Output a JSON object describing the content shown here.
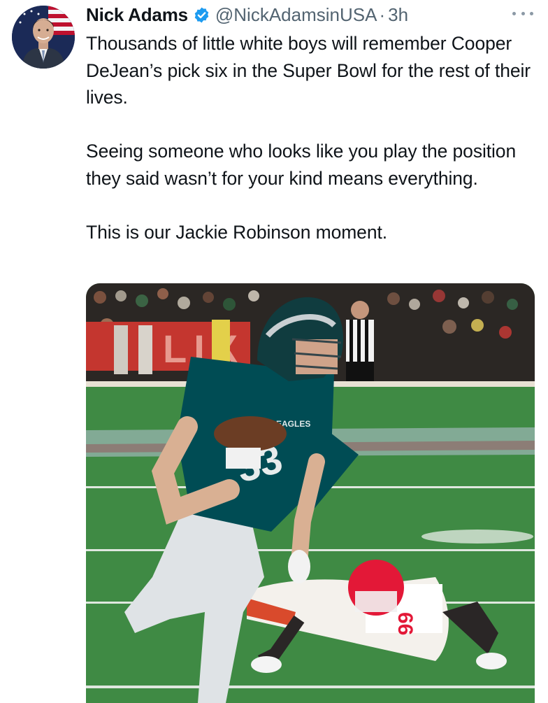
{
  "tweet": {
    "author": {
      "name": "Nick Adams",
      "handle": "@NickAdamsinUSA",
      "verified_icon": "verified-badge-icon",
      "avatar_icon": "profile-photo"
    },
    "separator": "·",
    "time": "3h",
    "menu_icon": "more-options-icon",
    "paragraphs": [
      "Thousands of little white boys will remember Cooper DeJean’s pick six in the Super Bowl for the rest of their lives.",
      "Seeing someone who looks like you play the position they said wasn’t for your kind means everything.",
      "This is our Jackie Robinson moment."
    ],
    "media": {
      "signage_text": "LIX",
      "jersey_text": "EAGLES",
      "player_number": "33",
      "opponent_number": "66"
    }
  },
  "colors": {
    "verified": "#1d9bf0",
    "secondary_text": "#536471",
    "eagles_green": "#004c54",
    "chiefs_red": "#e31837",
    "turf": "#3f8a44"
  }
}
